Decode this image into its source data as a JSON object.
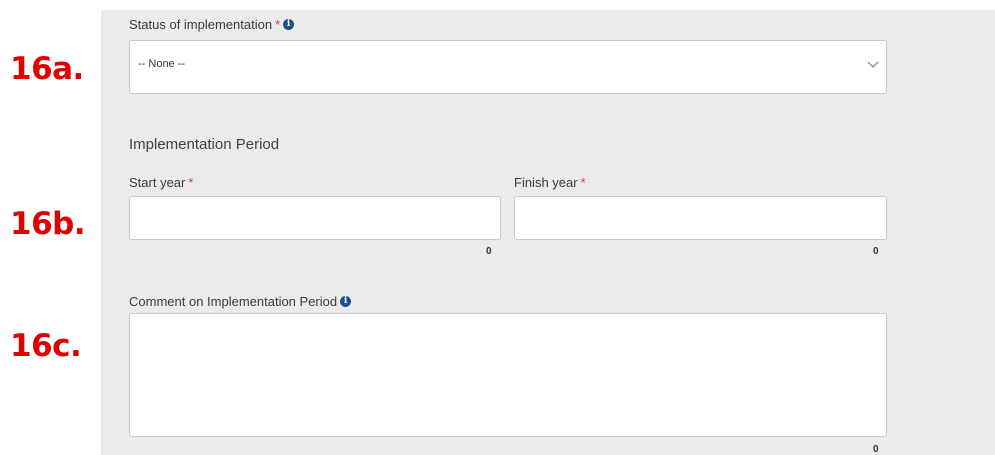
{
  "step_labels": {
    "a": "16a.",
    "b": "16b.",
    "c": "16c."
  },
  "status_field": {
    "label": "Status of implementation",
    "required_mark": "*",
    "info_glyph": "i",
    "selected_value": "-- None --"
  },
  "implementation_period": {
    "heading": "Implementation Period",
    "start_year": {
      "label": "Start year",
      "required_mark": "*",
      "value": "",
      "char_count": "0"
    },
    "finish_year": {
      "label": "Finish year",
      "required_mark": "*",
      "value": "",
      "char_count": "0"
    }
  },
  "comment_field": {
    "label": "Comment on Implementation Period",
    "info_glyph": "i",
    "value": "",
    "char_count": "0"
  },
  "colors": {
    "step_label": "#e00000",
    "panel_background": "#ebebeb",
    "required_mark": "#d04040",
    "info_icon": "#1f4e8c"
  },
  "icons": [
    "info-icon",
    "chevron-down-icon"
  ]
}
